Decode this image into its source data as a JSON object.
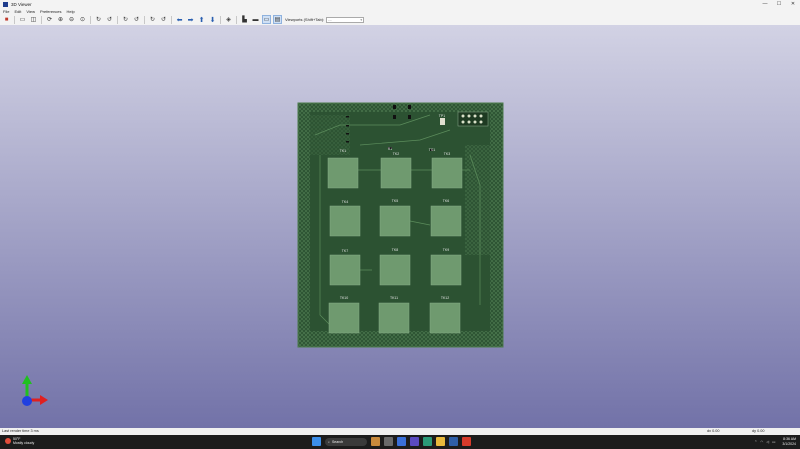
{
  "window": {
    "title": "3D Viewer",
    "controls": [
      "—",
      "☐",
      "✕"
    ]
  },
  "menu": [
    "File",
    "Edit",
    "View",
    "Preferences",
    "Help"
  ],
  "toolbar": {
    "viewports_label": "Viewports (Shift+Tab):",
    "viewports_value": "---"
  },
  "pcb": {
    "pad_labels": [
      "TK1",
      "TK2",
      "TK3",
      "TK4",
      "TK5",
      "TK6",
      "TK7",
      "TK8",
      "TK9",
      "TK10",
      "TK11",
      "TK12"
    ],
    "marks": [
      "TP1",
      "R1",
      "TS1"
    ]
  },
  "colors": {
    "board": "#2c5232",
    "pad": "#6f9a6f",
    "axis_x": "#e02020",
    "axis_y": "#20c020",
    "axis_z": "#2040e0"
  },
  "status": {
    "render_time": "Last render time 3 ms",
    "dx": "dx 0.00",
    "dy": "dy 0.00"
  },
  "taskbar": {
    "weather_temp": "50°F",
    "weather_desc": "Mostly cloudy",
    "search": "Search",
    "time": "8:36 AM",
    "date": "3/1/2024"
  }
}
